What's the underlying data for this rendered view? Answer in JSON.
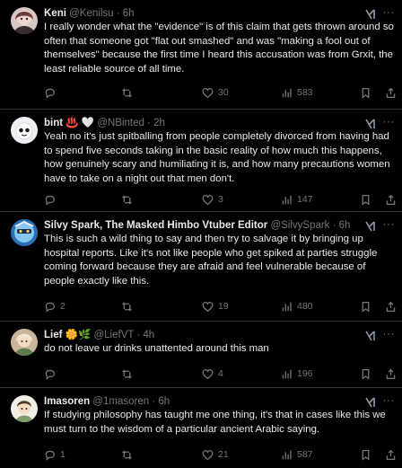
{
  "tweets": [
    {
      "name": "Keni",
      "handle": "@Kenilsu · 6h",
      "text": "I really wonder what the \"evidence\" is of this claim that gets thrown around so often that someone got \"flat out smashed\" and was \"making a fool out of themselves\" because the first time I heard this accusation was from Grxit, the least reliable source of all time.",
      "replies": "",
      "reposts": "",
      "likes": "30",
      "views": "583"
    },
    {
      "name": "bint ♨️ 🤍",
      "handle": "@NBinted · 2h",
      "text": "Yeah no it's just spitballing from people completely divorced from having had to spend five seconds taking in the basic reality of how much this happens, how genuinely scary and humiliating it is, and how many precautions women have to take on a night out that men don't.",
      "replies": "",
      "reposts": "",
      "likes": "3",
      "views": "147"
    },
    {
      "name": "Silvy Spark, The Masked Himbo Vtuber Editor",
      "handle": "@SilvySpark · 6h",
      "text": "This is such a wild thing to say and then try to salvage it by bringing up hospital reports. Like it's not like people who get spiked at parties struggle coming forward because they are afraid and feel vulnerable because of people exactly like this.",
      "replies": "2",
      "reposts": "",
      "likes": "19",
      "views": "480"
    },
    {
      "name": "Lief 🌼🌿",
      "handle": "@LiefVT · 4h",
      "text": "do not leave ur drinks unattented around this man",
      "replies": "",
      "reposts": "",
      "likes": "4",
      "views": "196"
    },
    {
      "name": "Imasoren",
      "handle": "@1masoren · 6h",
      "text": "If studying philosophy has taught me one thing, it's that in cases like this we must turn to the wisdom of a particular ancient Arabic saying.",
      "replies": "1",
      "reposts": "",
      "likes": "21",
      "views": "587"
    }
  ],
  "colors": {
    "background": "#000000",
    "text": "#e7e9ea",
    "muted": "#71767b",
    "divider": "#2f3336"
  },
  "icons": [
    "reply-icon",
    "repost-icon",
    "like-icon",
    "views-icon",
    "bookmark-icon",
    "share-icon",
    "grok-icon",
    "more-icon"
  ]
}
